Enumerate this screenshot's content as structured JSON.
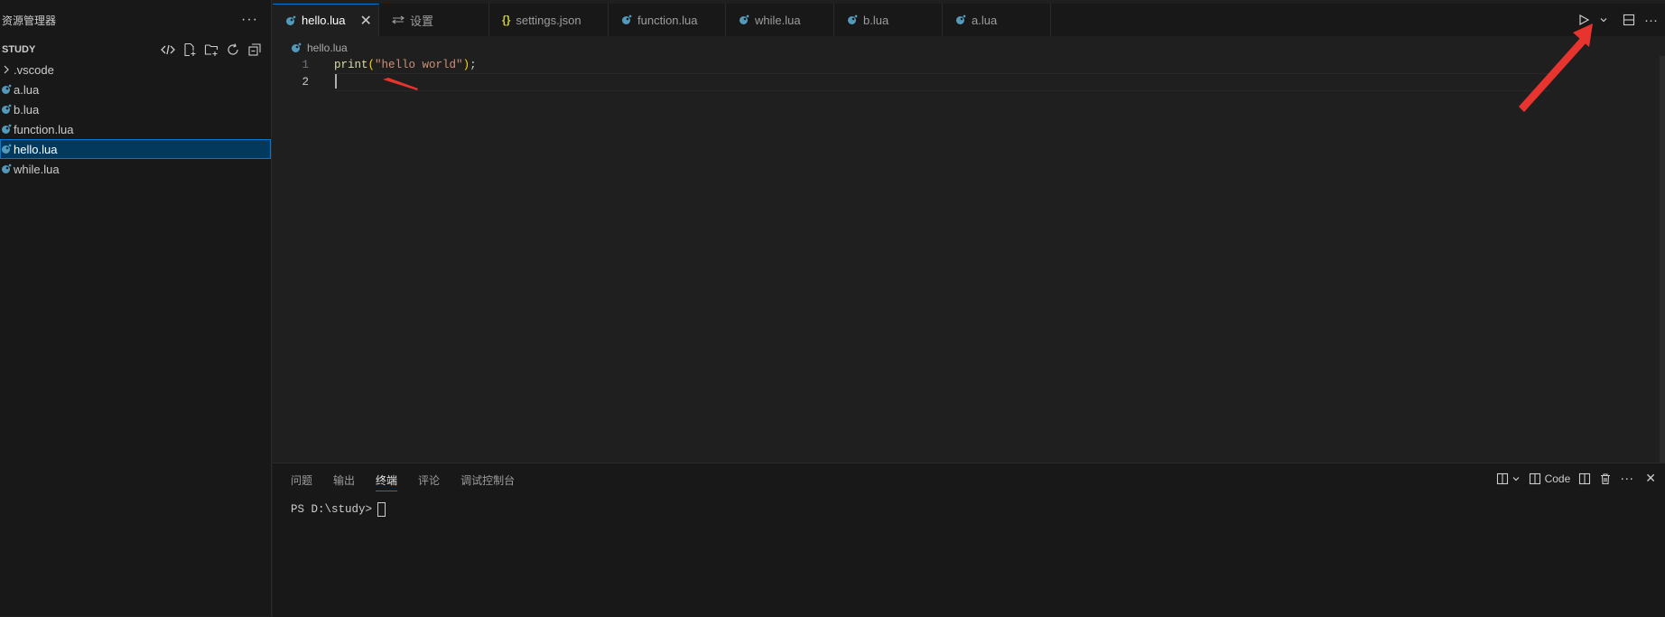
{
  "explorer": {
    "title": "资源管理器",
    "more": "···",
    "section": "STUDY",
    "items": [
      {
        "label": ".vscode",
        "kind": "folder",
        "selected": false
      },
      {
        "label": "a.lua",
        "kind": "lua",
        "selected": false
      },
      {
        "label": "b.lua",
        "kind": "lua",
        "selected": false
      },
      {
        "label": "function.lua",
        "kind": "lua",
        "selected": false
      },
      {
        "label": "hello.lua",
        "kind": "lua",
        "selected": true
      },
      {
        "label": "while.lua",
        "kind": "lua",
        "selected": false
      }
    ]
  },
  "tabs": [
    {
      "label": "hello.lua",
      "icon": "lua-icon",
      "active": true
    },
    {
      "label": "设置",
      "icon": "settings-icon",
      "active": false
    },
    {
      "label": "settings.json",
      "icon": "json-icon",
      "active": false
    },
    {
      "label": "function.lua",
      "icon": "lua-icon",
      "active": false
    },
    {
      "label": "while.lua",
      "icon": "lua-icon",
      "active": false
    },
    {
      "label": "b.lua",
      "icon": "lua-icon",
      "active": false
    },
    {
      "label": "a.lua",
      "icon": "lua-icon",
      "active": false
    }
  ],
  "breadcrumb": "hello.lua",
  "editor": {
    "lines": [
      {
        "num": "1",
        "fn": "print",
        "open": "(",
        "str": "\"hello world\"",
        "close": ")",
        "tail": ";"
      },
      {
        "num": "2"
      }
    ]
  },
  "panel": {
    "tabs": [
      "问题",
      "输出",
      "终端",
      "评论",
      "调试控制台"
    ],
    "active_tab": "终端",
    "profile_label": "Code",
    "prompt": "PS D:\\study>"
  },
  "colors": {
    "accent": "#0078d4",
    "lua_icon": "#519aba",
    "annotation": "#e8342f"
  }
}
